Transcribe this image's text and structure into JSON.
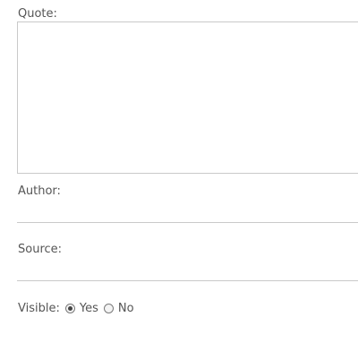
{
  "form": {
    "quote": {
      "label": "Quote:",
      "value": ""
    },
    "author": {
      "label": "Author:",
      "value": ""
    },
    "source": {
      "label": "Source:",
      "value": ""
    },
    "visible": {
      "label": "Visible:",
      "options": [
        {
          "label": "Yes",
          "selected": true
        },
        {
          "label": "No",
          "selected": false
        }
      ]
    }
  }
}
